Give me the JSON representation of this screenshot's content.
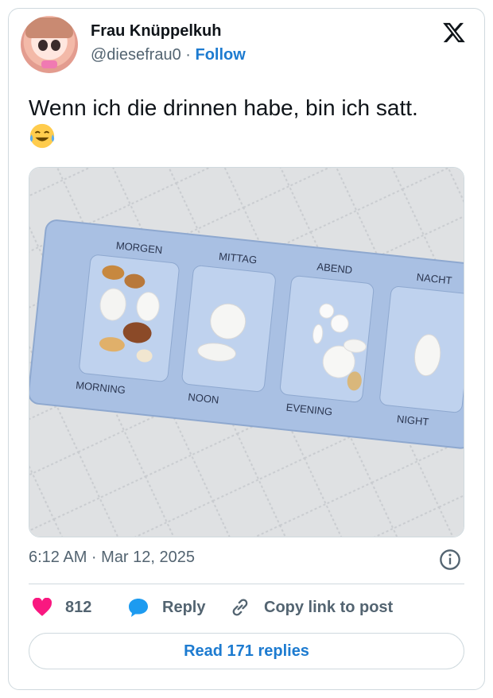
{
  "author": {
    "name": "Frau Knüppelkuh",
    "handle": "@diesefrau0",
    "separator": "·",
    "follow_label": "Follow"
  },
  "tweet": {
    "text": "Wenn ich die drinnen habe, bin ich satt.",
    "emoji_icon": "face-with-tears-of-joy-icon",
    "timestamp": "6:12 AM · Mar 12, 2025"
  },
  "media": {
    "organizer_labels_top": [
      "MORGEN",
      "MITTAG",
      "ABEND",
      "NACHT"
    ],
    "organizer_labels_bottom": [
      "MORNING",
      "NOON",
      "EVENING",
      "NIGHT"
    ]
  },
  "actions": {
    "like_count": "812",
    "reply_label": "Reply",
    "copy_label": "Copy link to post"
  },
  "read_replies_label": "Read 171 replies",
  "colors": {
    "accent": "#1d7bd0",
    "like": "#f91880",
    "reply_icon": "#1d9bf0",
    "muted": "#536471",
    "border": "#cfd9de",
    "organizer": "#a9c0e3"
  }
}
